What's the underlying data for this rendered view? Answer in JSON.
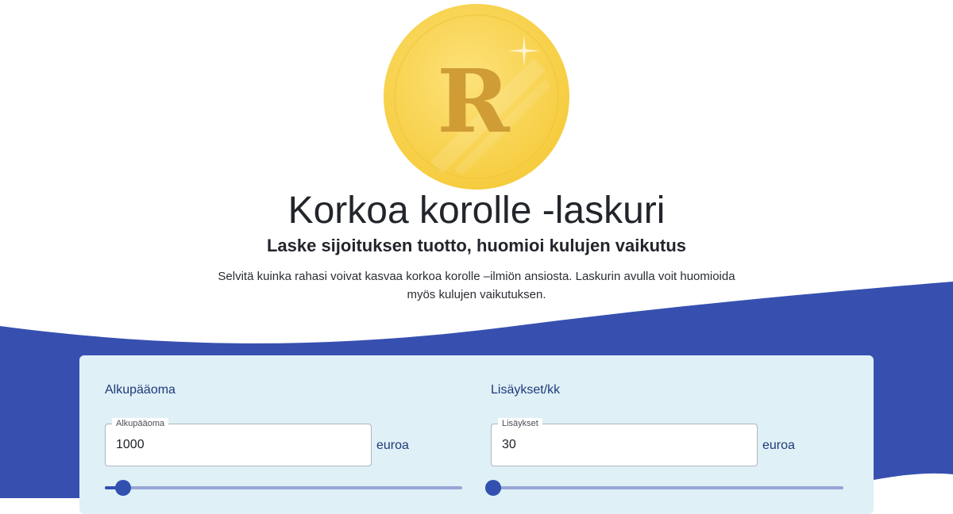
{
  "hero": {
    "coin_letter": "R",
    "title": "Korkoa korolle -laskuri",
    "subtitle": "Laske sijoituksen tuotto, huomioi kulujen vaikutus",
    "description": "Selvitä kuinka rahasi voivat kasvaa korkoa korolle –ilmiön ansiosta. Laskurin avulla voit huomioida myös kulujen vaikutuksen."
  },
  "colors": {
    "accent": "#3750b0",
    "heading": "#1f3a78",
    "card_bg": "#dff0f7",
    "coin": "#fbd653"
  },
  "calculator": {
    "initial": {
      "heading": "Alkupääoma",
      "field_label": "Alkupääoma",
      "value": "1000",
      "unit": "euroa",
      "slider_fraction": 0.05
    },
    "monthly": {
      "heading": "Lisäykset/kk",
      "field_label": "Lisäykset",
      "value": "30",
      "unit": "euroa",
      "slider_fraction": 0.02
    }
  }
}
